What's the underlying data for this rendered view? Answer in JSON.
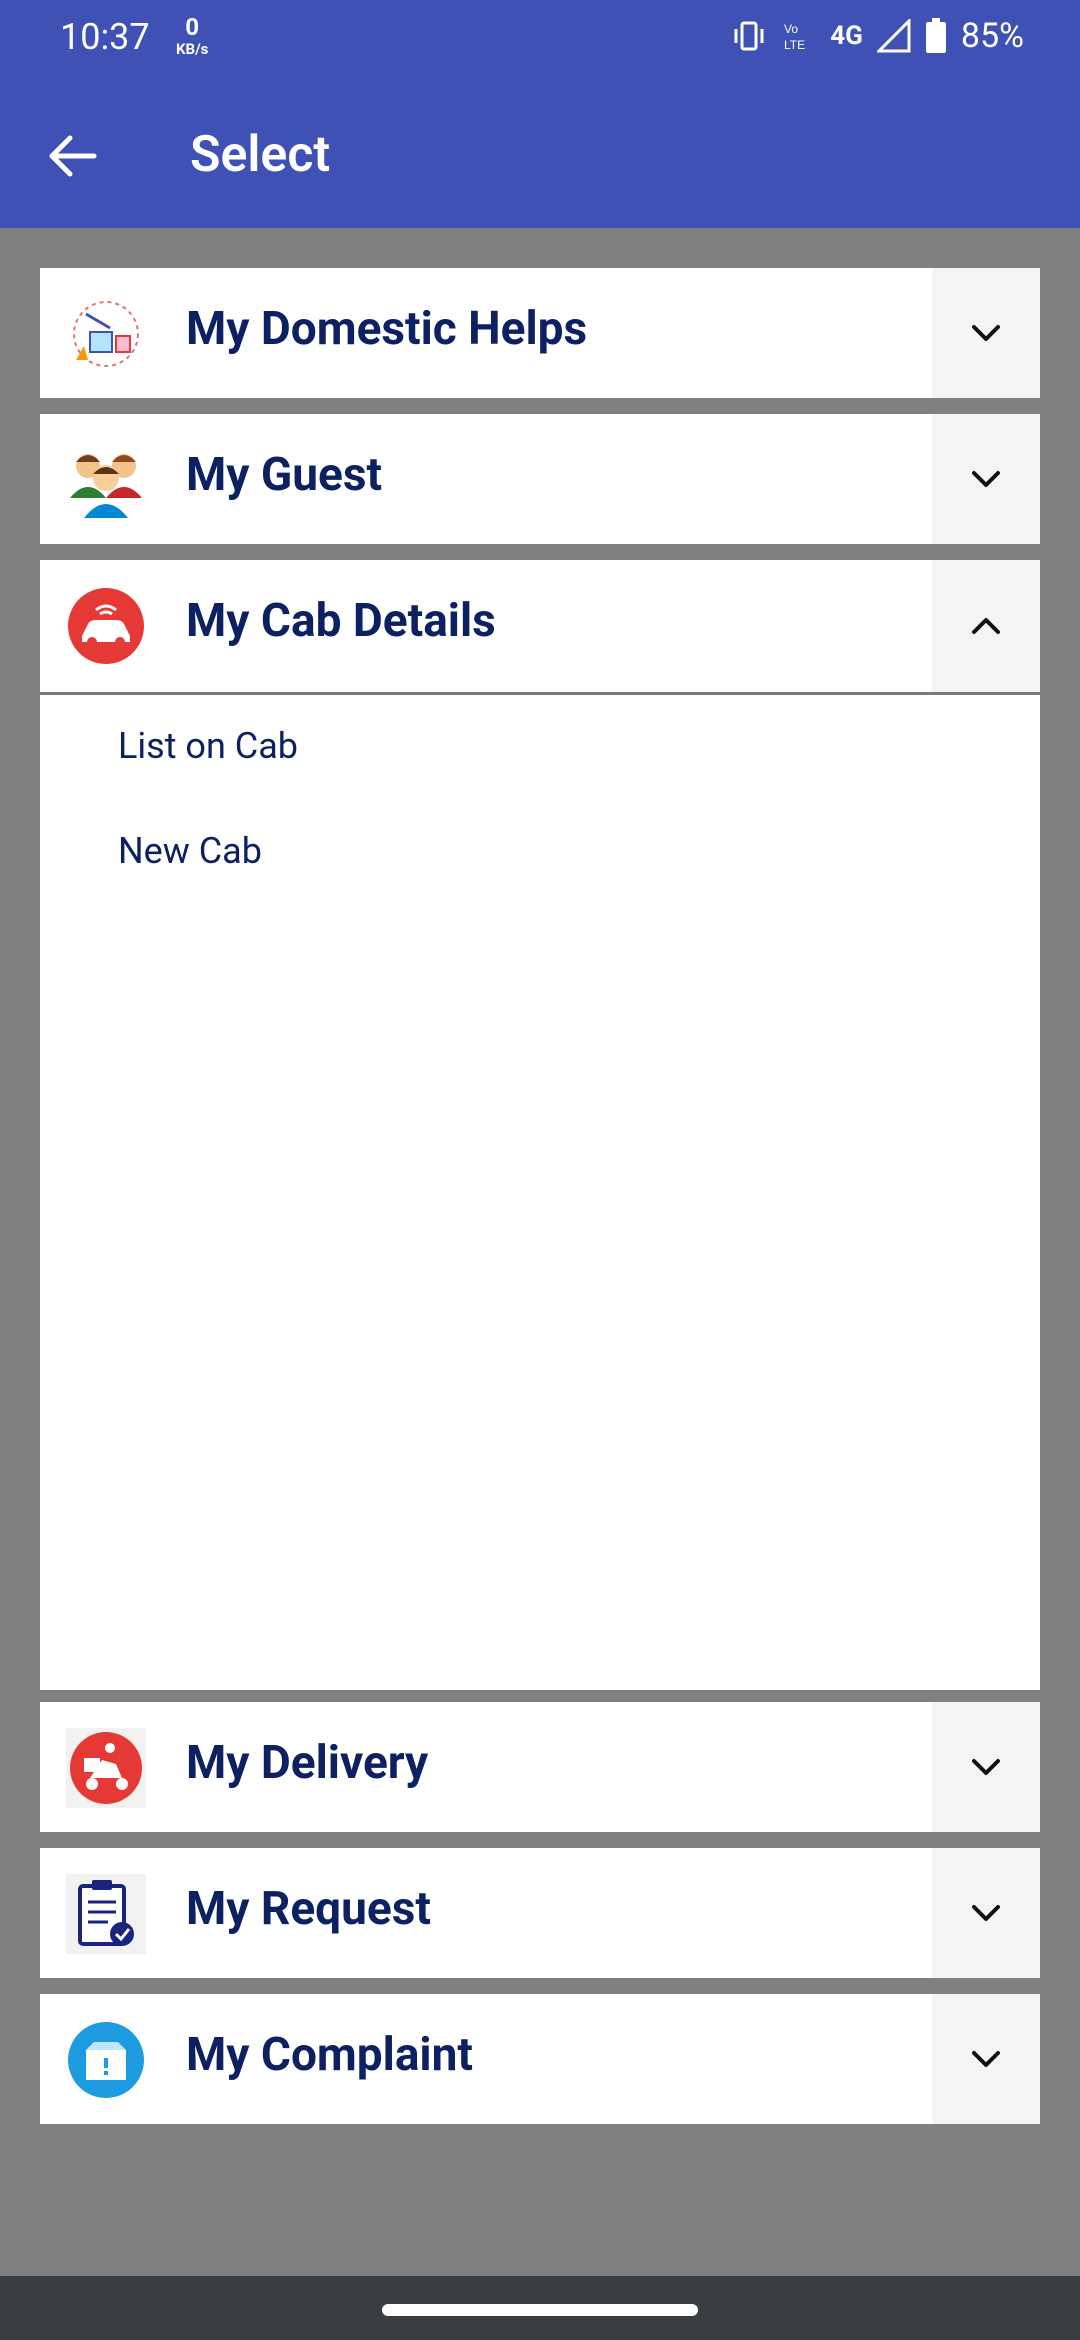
{
  "status_bar": {
    "time": "10:37",
    "net_speed_value": "0",
    "net_speed_unit": "KB/s",
    "network": "4G",
    "battery": "85%"
  },
  "app_bar": {
    "title": "Select"
  },
  "sections": [
    {
      "title": "My Domestic Helps",
      "icon": "domestic-helps-icon",
      "expanded": false
    },
    {
      "title": "My Guest",
      "icon": "guest-icon",
      "expanded": false
    },
    {
      "title": "My Cab Details",
      "icon": "cab-icon",
      "expanded": true,
      "items": [
        "List on Cab",
        "New Cab"
      ]
    },
    {
      "title": "My Delivery",
      "icon": "delivery-icon",
      "expanded": false
    },
    {
      "title": "My Request",
      "icon": "request-icon",
      "expanded": false
    },
    {
      "title": "My Complaint",
      "icon": "complaint-icon",
      "expanded": false
    }
  ],
  "colors": {
    "primary": "#3f51b5",
    "title_text": "#0d2162",
    "background": "#808080"
  }
}
